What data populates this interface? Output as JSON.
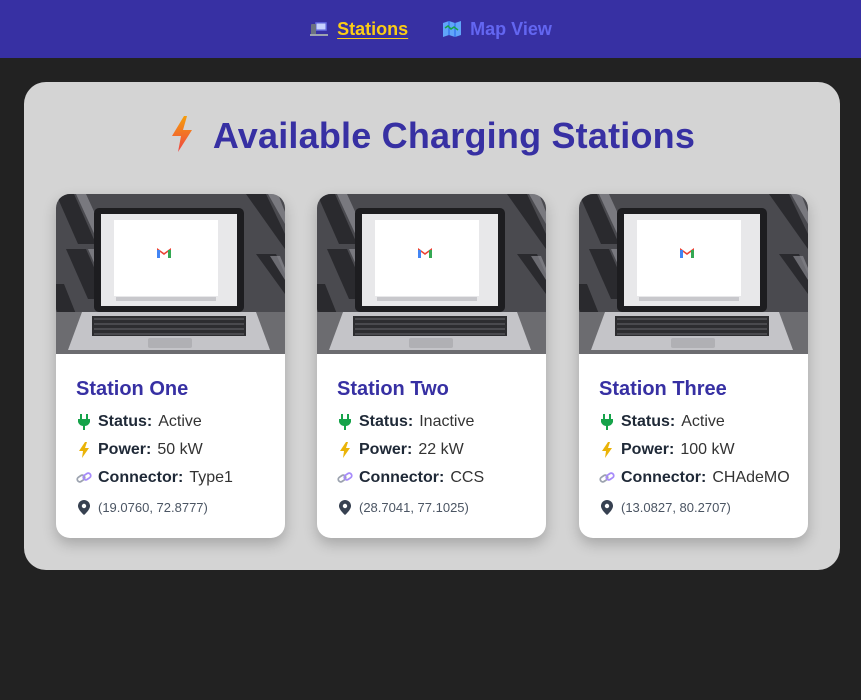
{
  "nav": {
    "stations_label": "Stations",
    "map_label": "Map View",
    "active_color": "#facc15",
    "inactive_color": "#6366f1"
  },
  "page": {
    "title": "Available Charging Stations"
  },
  "labels": {
    "status": "Status:",
    "power": "Power:",
    "connector": "Connector:"
  },
  "stations": [
    {
      "name": "Station One",
      "status": "Active",
      "power": "50 kW",
      "connector": "Type1",
      "coords": "(19.0760, 72.8777)"
    },
    {
      "name": "Station Two",
      "status": "Inactive",
      "power": "22 kW",
      "connector": "CCS",
      "coords": "(28.7041, 77.1025)"
    },
    {
      "name": "Station Three",
      "status": "Active",
      "power": "100 kW",
      "connector": "CHAdeMO",
      "coords": "(13.0827, 80.2707)"
    }
  ],
  "colors": {
    "navbar": "#3730a3",
    "panel": "#d4d4d4",
    "heading": "#3730a3",
    "plug_icon": "#16a34a",
    "bolt_icon": "#eab308"
  }
}
